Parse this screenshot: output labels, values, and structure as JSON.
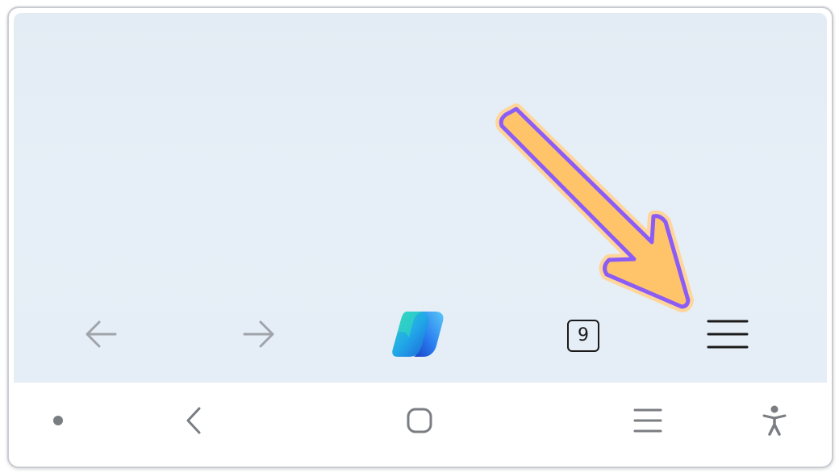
{
  "browser_toolbar": {
    "back_icon": "arrow-left-icon",
    "forward_icon": "arrow-right-icon",
    "copilot_icon": "copilot-logo-icon",
    "tab_count": "9",
    "menu_icon": "hamburger-menu-icon"
  },
  "system_nav": {
    "dot_icon": "dot-icon",
    "back_icon": "chevron-left-icon",
    "home_icon": "rounded-square-home-icon",
    "recents_icon": "recents-lines-icon",
    "accessibility_icon": "accessibility-person-icon"
  },
  "annotation": {
    "arrow_icon": "callout-arrow-icon",
    "arrow_fill": "#ffc56b",
    "arrow_stroke": "#8b5cf6"
  },
  "colors": {
    "browser_background": "#e5edf6",
    "nav_background": "#ffffff",
    "icon_disabled": "#9aa0a6",
    "icon_dark": "#1a1a1a"
  }
}
